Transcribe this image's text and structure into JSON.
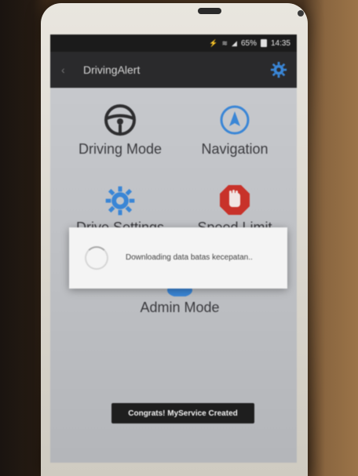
{
  "status_bar": {
    "battery": "65%",
    "time": "14:35"
  },
  "app": {
    "title": "DrivingAlert"
  },
  "tiles": [
    {
      "label": "Driving Mode",
      "icon": "steering-wheel-icon"
    },
    {
      "label": "Navigation",
      "icon": "navigation-arrow-icon"
    },
    {
      "label": "Drive Settings",
      "icon": "gear-icon"
    },
    {
      "label": "Speed Limit",
      "icon": "stop-hand-icon"
    },
    {
      "label": "Admin Mode",
      "icon": "admin-icon"
    }
  ],
  "dialog": {
    "message": "Downloading data batas kecepatan.."
  },
  "toast": {
    "message": "Congrats! MyService Created"
  },
  "colors": {
    "accent_blue": "#3a86d6",
    "stop_red": "#c8322a",
    "action_bar": "#2a2a2c"
  }
}
